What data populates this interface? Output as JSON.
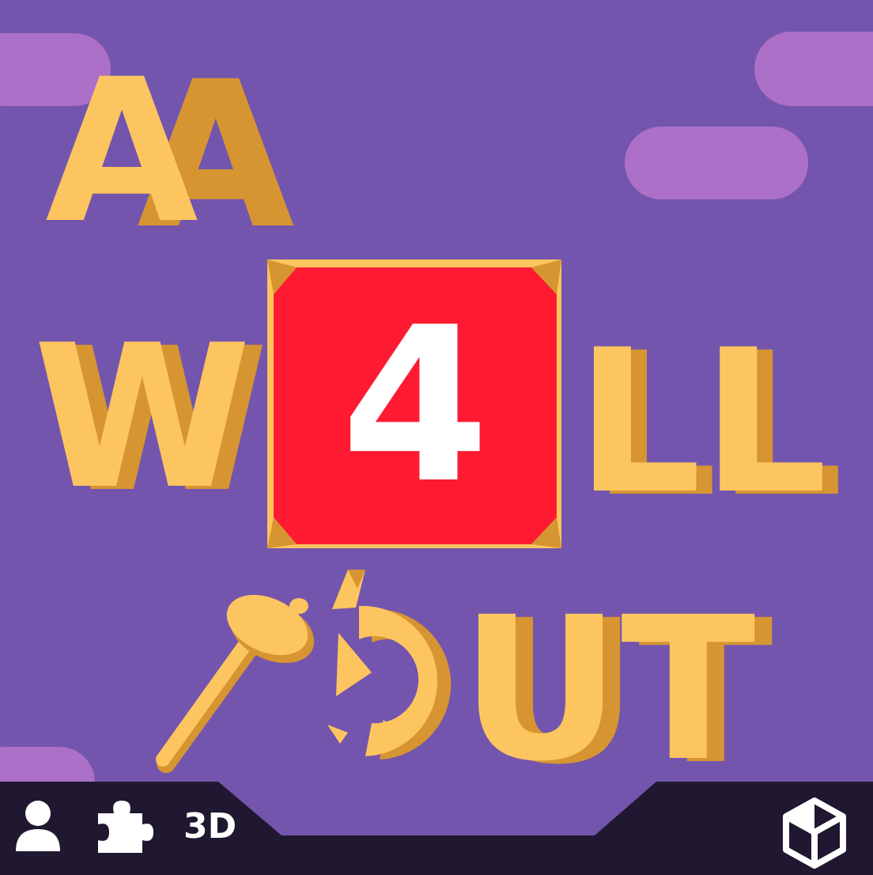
{
  "game": {
    "title_word_1": "A",
    "title_word_2_prefix": "W",
    "title_badge_number": "4",
    "title_word_2_suffix": "LL",
    "title_word_3_suffix": "UT"
  },
  "bottom_bar": {
    "tag_3d": "3D",
    "icons": [
      "user-icon",
      "puzzle-icon",
      "unity-logo-icon"
    ]
  },
  "colors": {
    "background": "#7455ad",
    "cloud": "#ac70c9",
    "letter_front": "#fdc55f",
    "letter_shadow": "#d69531",
    "badge_red": "#fe1b32",
    "bar": "#1f1830"
  }
}
